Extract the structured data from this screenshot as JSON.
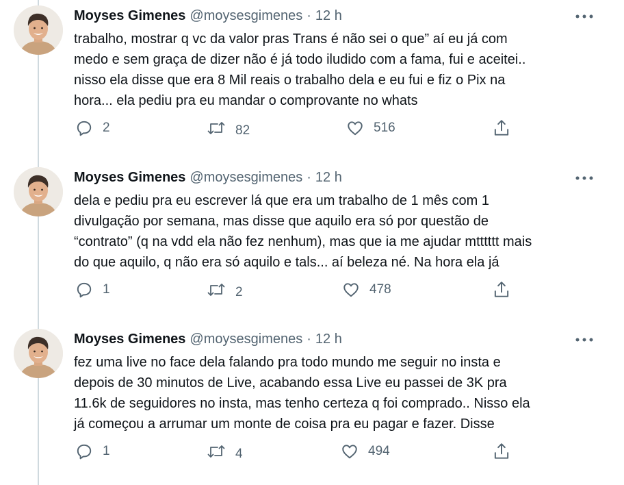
{
  "tweets": [
    {
      "author": "Moyses Gimenes",
      "handle": "@moysesgimenes",
      "dot": "·",
      "time": "12 h",
      "lines": [
        "trabalho, mostrar q vc da valor pras Trans é não sei o que” aí eu já com",
        "medo e sem graça de dizer não é já todo iludido com a fama, fui e aceitei..",
        "nisso ela disse que era 8 Mil reais o trabalho dela e eu fui e fiz o Pix na",
        "hora... ela pediu pra eu mandar o comprovante no whats"
      ],
      "replies": "2",
      "retweets": "82",
      "likes": "516"
    },
    {
      "author": "Moyses Gimenes",
      "handle": "@moysesgimenes",
      "dot": "·",
      "time": "12 h",
      "lines": [
        "dela e pediu pra eu escrever lá que era um trabalho de 1 mês com 1",
        "divulgação por semana, mas disse que aquilo era só por questão de",
        "“contrato” (q na vdd ela não fez nenhum), mas que ia me ajudar mtttttt mais",
        "do que aquilo, q não era só aquilo e tals... aí beleza né. Na hora ela já"
      ],
      "replies": "1",
      "retweets": "2",
      "likes": "478"
    },
    {
      "author": "Moyses Gimenes",
      "handle": "@moysesgimenes",
      "dot": "·",
      "time": "12 h",
      "lines": [
        "fez uma live no face dela falando pra todo mundo me seguir no insta e",
        "depois de 30 minutos de Live, acabando essa Live eu passei de 3K pra",
        "11.6k de seguidores no insta, mas tenho certeza q foi comprado.. Nisso ela",
        "já começou a arrumar um monte de coisa pra eu pagar e fazer. Disse"
      ],
      "replies": "1",
      "retweets": "4",
      "likes": "494"
    }
  ],
  "icons": {
    "more": "more-horizontal-icon",
    "reply": "reply-icon",
    "retweet": "retweet-icon",
    "like": "heart-icon",
    "share": "share-icon"
  },
  "colors": {
    "text": "#0f1419",
    "secondary": "#536471",
    "thread_line": "#cfd9de"
  }
}
